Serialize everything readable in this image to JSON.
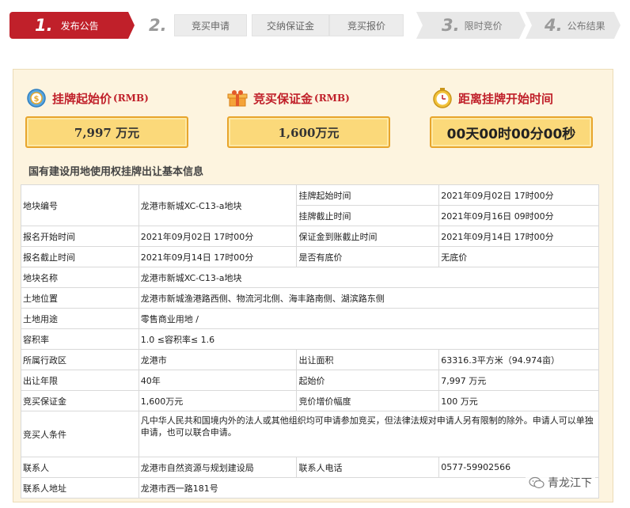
{
  "steps": [
    {
      "num": "1.",
      "label": "发布公告",
      "state": "active"
    },
    {
      "num": "2.",
      "label": "",
      "state": "pending"
    },
    {
      "num": "",
      "label": "竞买申请",
      "state": "sub"
    },
    {
      "num": "",
      "label": "交纳保证金",
      "state": "sub"
    },
    {
      "num": "",
      "label": "竞买报价",
      "state": "sub"
    },
    {
      "num": "3.",
      "label": "限时竞价",
      "state": "pending"
    },
    {
      "num": "4.",
      "label": "公布结果",
      "state": "pending"
    }
  ],
  "summary": {
    "start_price_label": "挂牌起始价",
    "start_price_unit": "(RMB)",
    "start_price_value": "7,997 万元",
    "deposit_label": "竞买保证金",
    "deposit_unit": "(RMB)",
    "deposit_value": "1,600万元",
    "countdown_label": "距离挂牌开始时间",
    "countdown_value": "00天00时00分00秒"
  },
  "section_title": "国有建设用地使用权挂牌出让基本信息",
  "table": {
    "parcel_no_k": "地块编号",
    "parcel_no_v": "龙港市新城XC-C13-a地块",
    "listing_start_k": "挂牌起始时间",
    "listing_start_v": "2021年09月02日 17时00分",
    "listing_end_k": "挂牌截止时间",
    "listing_end_v": "2021年09月16日 09时00分",
    "reg_start_k": "报名开始时间",
    "reg_start_v": "2021年09月02日 17时00分",
    "deposit_deadline_k": "保证金到账截止时间",
    "deposit_deadline_v": "2021年09月14日 17时00分",
    "reg_end_k": "报名截止时间",
    "reg_end_v": "2021年09月14日 17时00分",
    "reserve_k": "是否有底价",
    "reserve_v": "无底价",
    "parcel_name_k": "地块名称",
    "parcel_name_v": "龙港市新城XC-C13-a地块",
    "location_k": "土地位置",
    "location_v": "龙港市新城渔港路西侧、物流河北侧、海丰路南侧、湖滨路东侧",
    "use_k": "土地用途",
    "use_v": "零售商业用地 /",
    "far_k": "容积率",
    "far_v": "1.0 ≤容积率≤ 1.6",
    "district_k": "所属行政区",
    "district_v": "龙港市",
    "area_k": "出让面积",
    "area_v": "63316.3平方米（94.974亩）",
    "term_k": "出让年限",
    "term_v": "40年",
    "start_price_k": "起始价",
    "start_price_v": "7,997 万元",
    "deposit_k": "竞买保证金",
    "deposit_v": "1,600万元",
    "increment_k": "竞价增价幅度",
    "increment_v": "100 万元",
    "bidder_k": "竞买人条件",
    "bidder_v": "凡中华人民共和国境内外的法人或其他组织均可申请参加竞买，但法律法规对申请人另有限制的除外。申请人可以单独申请，也可以联合申请。",
    "contact_k": "联系人",
    "contact_v": "龙港市自然资源与规划建设局",
    "phone_k": "联系人电话",
    "phone_v": "0577-59902566",
    "address_k": "联系人地址",
    "address_v": "龙港市西一路181号"
  },
  "watermark": "青龙江下",
  "colors": {
    "accent_red": "#c0202a",
    "panel_bg": "#fdf4df",
    "price_box": "#fbd97a",
    "price_border": "#e8a52c"
  }
}
